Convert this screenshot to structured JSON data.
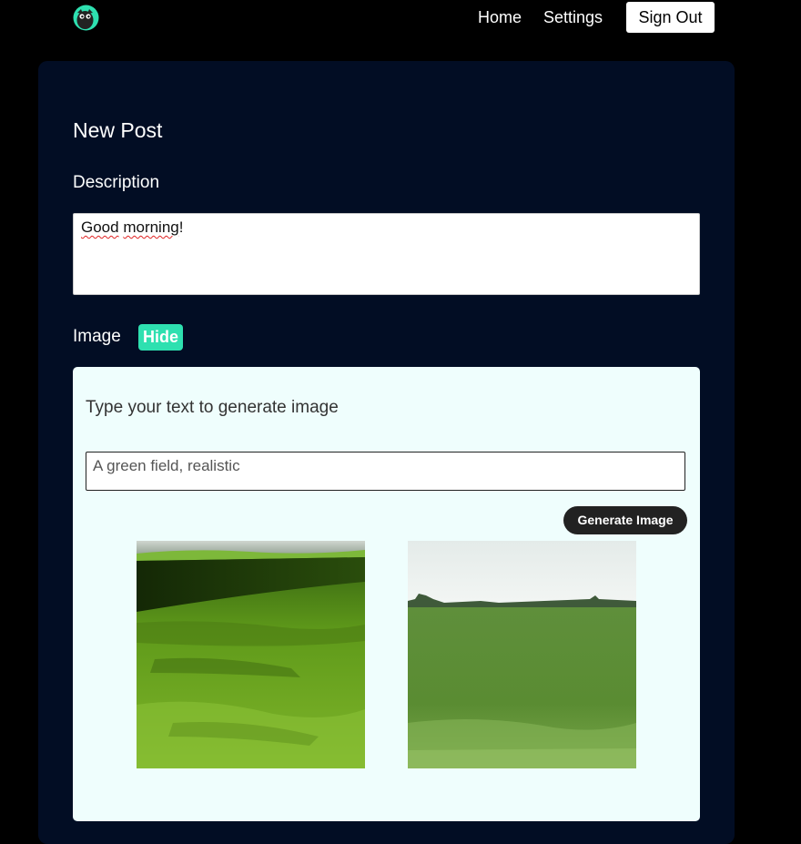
{
  "nav": {
    "logo_icon": "owl-logo-icon",
    "home_label": "Home",
    "settings_label": "Settings",
    "signout_label": "Sign Out"
  },
  "post": {
    "title": "New Post",
    "description_label": "Description",
    "description_word1": "Good",
    "description_word2": "morning",
    "description_tail": "!"
  },
  "image_section": {
    "label": "Image",
    "hide_label": "Hide",
    "heading": "Type your text to generate image",
    "prompt_value": "A green field, realistic",
    "generate_label": "Generate Image",
    "images": [
      {
        "icon": "generated-image-grass-closeup"
      },
      {
        "icon": "generated-image-green-field"
      }
    ]
  },
  "colors": {
    "background": "#000000",
    "card": "#020d24",
    "accent": "#2ee0b0",
    "panel": "#effefd",
    "button_dark": "#222222"
  }
}
